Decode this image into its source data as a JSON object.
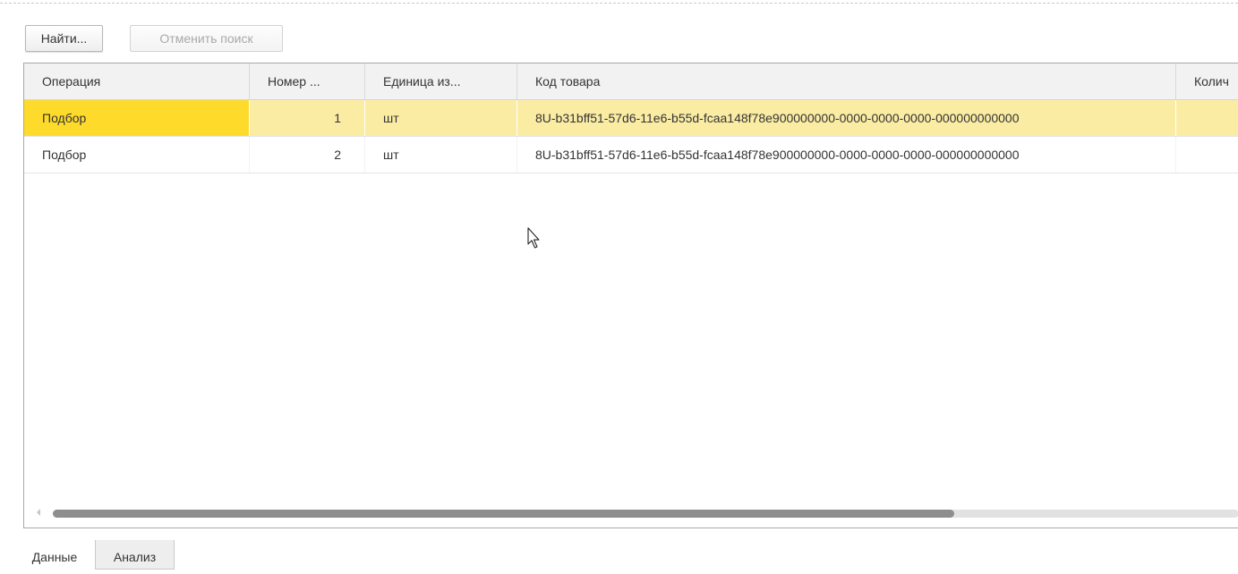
{
  "toolbar": {
    "find_label": "Найти...",
    "cancel_search_label": "Отменить поиск"
  },
  "table": {
    "columns": [
      "Операция",
      "Номер ...",
      "Единица из...",
      "Код товара",
      "Колич"
    ],
    "rows": [
      [
        "Подбор",
        "1",
        "шт",
        "8U-b31bff51-57d6-11e6-b55d-fcaa148f78e900000000-0000-0000-0000-000000000000",
        ""
      ],
      [
        "Подбор",
        "2",
        "шт",
        "8U-b31bff51-57d6-11e6-b55d-fcaa148f78e900000000-0000-0000-0000-000000000000",
        ""
      ]
    ],
    "selected_row_index": 0
  },
  "tabs": {
    "items": [
      {
        "label": "Данные",
        "active": true
      },
      {
        "label": "Анализ",
        "active": false
      }
    ]
  },
  "colors": {
    "selected_row": "#fbeca4",
    "current_cell": "#fedb2a",
    "header_bg": "#f2f2f2"
  }
}
